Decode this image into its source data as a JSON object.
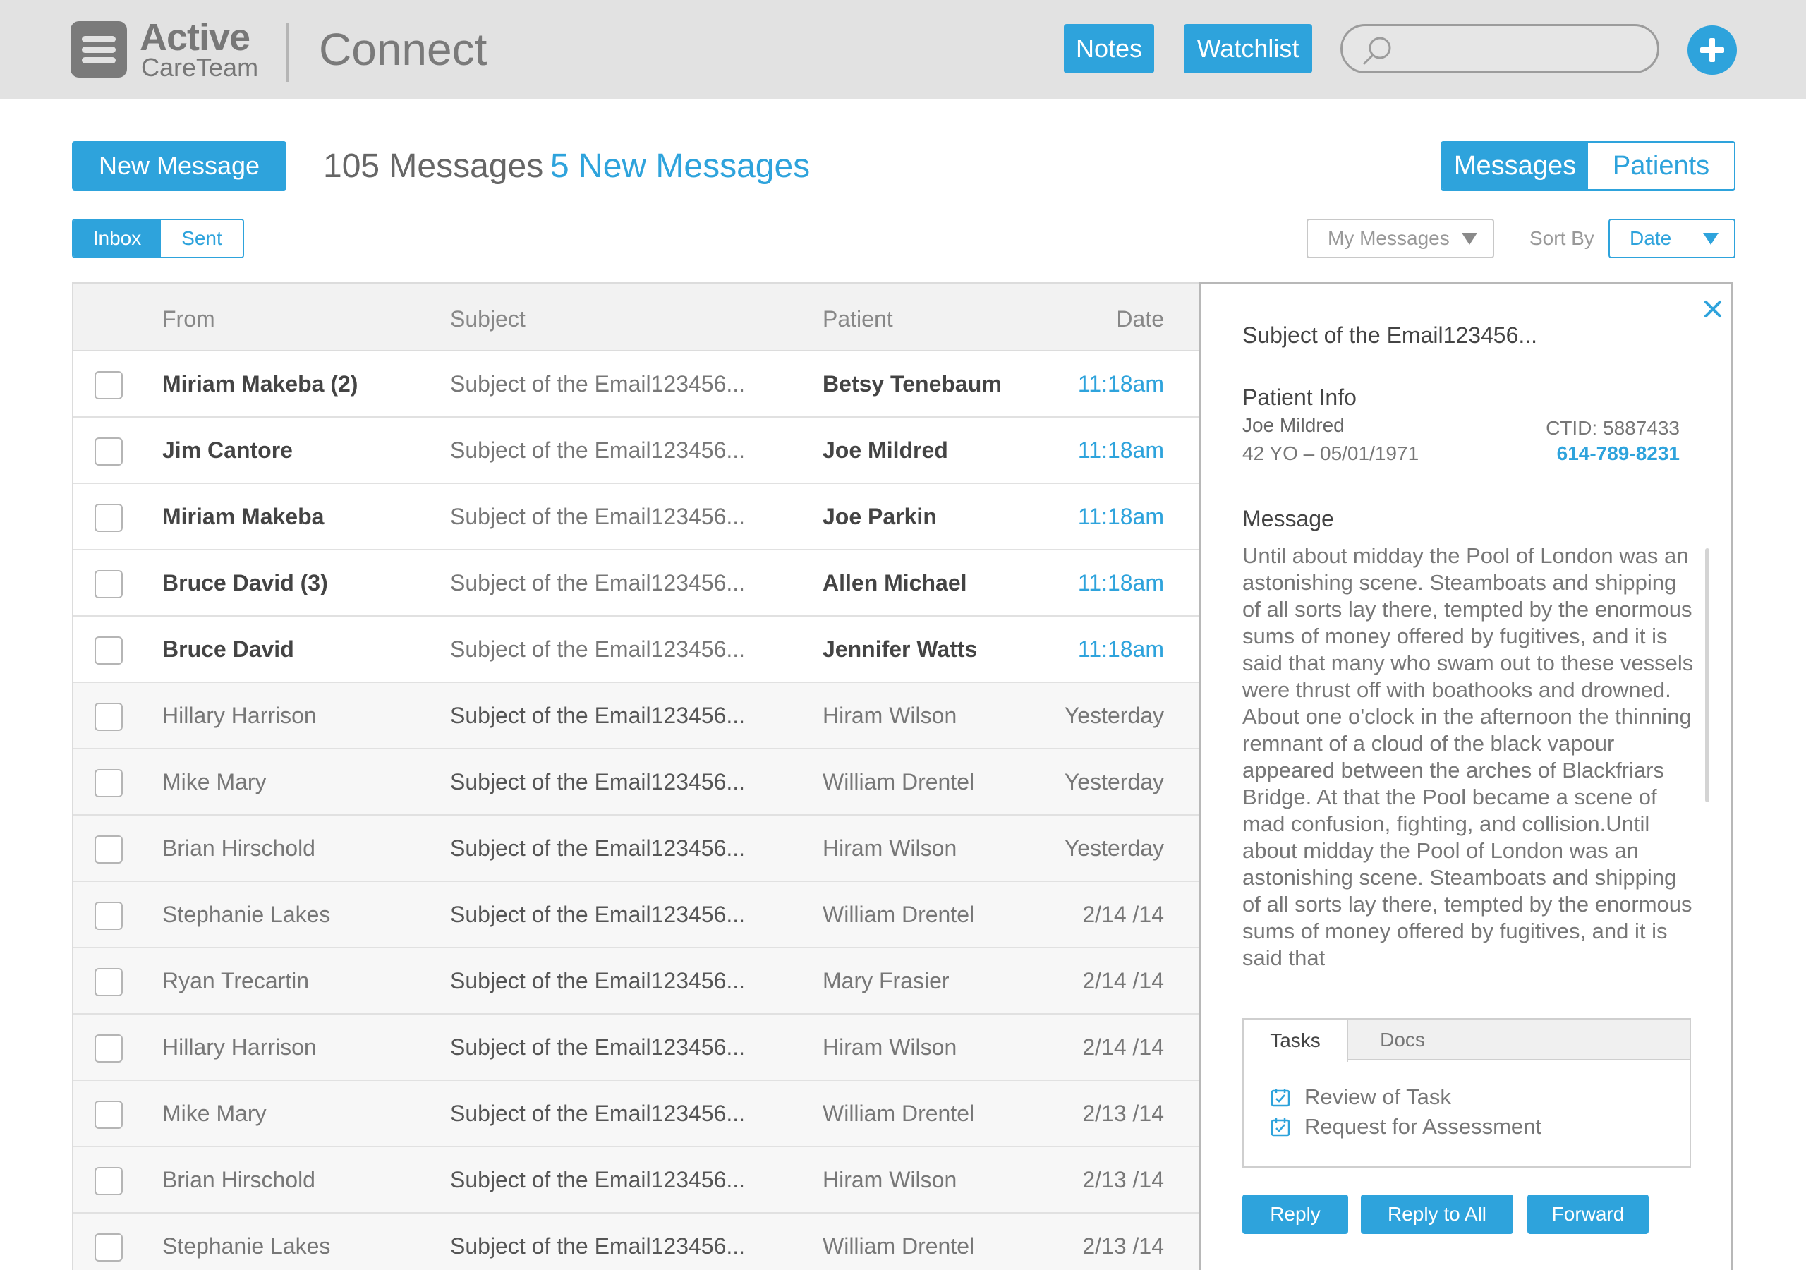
{
  "header": {
    "logo_line1": "Active",
    "logo_line2": "CareTeam",
    "app_title": "Connect",
    "notes_label": "Notes",
    "watchlist_label": "Watchlist",
    "search_placeholder": "",
    "add_icon": "plus-icon"
  },
  "toolbar": {
    "new_message_label": "New Message",
    "message_count": "105 Messages",
    "new_count": "5 New Messages",
    "view_tabs": [
      "Messages",
      "Patients"
    ],
    "active_view": "Messages",
    "box_tabs": [
      "Inbox",
      "Sent"
    ],
    "active_box": "Inbox",
    "filter_value": "My Messages",
    "sort_label": "Sort By",
    "sort_value": "Date"
  },
  "table": {
    "columns": [
      "From",
      "Subject",
      "Patient",
      "Date"
    ],
    "rows": [
      {
        "from": "Miriam Makeba (2)",
        "subject": "Subject of the Email123456...",
        "patient": "Betsy Tenebaum",
        "date": "11:18am",
        "state": "new"
      },
      {
        "from": "Jim Cantore",
        "subject": "Subject of the Email123456...",
        "patient": "Joe Mildred",
        "date": "11:18am",
        "state": "new selected"
      },
      {
        "from": "Miriam Makeba",
        "subject": "Subject of the Email123456...",
        "patient": "Joe Parkin",
        "date": "11:18am",
        "state": "new"
      },
      {
        "from": "Bruce David (3)",
        "subject": "Subject of the Email123456...",
        "patient": "Allen Michael",
        "date": "11:18am",
        "state": "new"
      },
      {
        "from": "Bruce David",
        "subject": "Subject of the Email123456...",
        "patient": "Jennifer Watts",
        "date": "11:18am",
        "state": "new"
      },
      {
        "from": "Hillary Harrison",
        "subject": "Subject of the Email123456...",
        "patient": "Hiram Wilson",
        "date": "Yesterday",
        "state": "old"
      },
      {
        "from": "Mike Mary",
        "subject": "Subject of the Email123456...",
        "patient": "William Drentel",
        "date": "Yesterday",
        "state": "old"
      },
      {
        "from": "Brian Hirschold",
        "subject": "Subject of the Email123456...",
        "patient": "Hiram Wilson",
        "date": "Yesterday",
        "state": "old"
      },
      {
        "from": "Stephanie Lakes",
        "subject": "Subject of the Email123456...",
        "patient": "William Drentel",
        "date": "2/14 /14",
        "state": "old"
      },
      {
        "from": "Ryan Trecartin",
        "subject": "Subject of the Email123456...",
        "patient": "Mary Frasier",
        "date": "2/14 /14",
        "state": "old"
      },
      {
        "from": "Hillary Harrison",
        "subject": "Subject of the Email123456...",
        "patient": "Hiram Wilson",
        "date": "2/14 /14",
        "state": "old"
      },
      {
        "from": "Mike Mary",
        "subject": "Subject of the Email123456...",
        "patient": "William Drentel",
        "date": "2/13 /14",
        "state": "old"
      },
      {
        "from": "Brian Hirschold",
        "subject": "Subject of the Email123456...",
        "patient": "Hiram Wilson",
        "date": "2/13 /14",
        "state": "old"
      },
      {
        "from": "Stephanie Lakes",
        "subject": "Subject of the Email123456...",
        "patient": "William Drentel",
        "date": "2/13 /14",
        "state": "old"
      }
    ]
  },
  "detail": {
    "subject": "Subject of the Email123456...",
    "patient_info_heading": "Patient Info",
    "patient_name": "Joe Mildred",
    "patient_age": "42 YO – 05/01/1971",
    "ctid": "CTID: 5887433",
    "phone": "614-789-8231",
    "message_heading": "Message",
    "message_body": "Until about midday the Pool of London was an astonishing scene. Steamboats and shipping of all sorts lay there, tempted by the enormous sums of money offered by fugitives, and it is said that many who swam out to these vessels were thrust off with boathooks and drowned. About one o'clock in the afternoon the thinning remnant of a cloud of the black vapour appeared between the arches of Blackfriars Bridge. At that the Pool became a scene of mad confusion, fighting, and collision.Until about midday the Pool of London was an astonishing scene. Steamboats and shipping of all sorts lay there, tempted by the enormous sums of money offered by fugitives, and it is said that",
    "tabs": [
      "Tasks",
      "Docs"
    ],
    "active_tab": "Tasks",
    "tasks": [
      "Review of Task",
      "Request for Assessment"
    ],
    "reply_label": "Reply",
    "reply_all_label": "Reply to All",
    "forward_label": "Forward"
  },
  "colors": {
    "accent": "#2ea3dc",
    "header_bg": "#e2e2e2",
    "selected_row": "#e7f3f9"
  }
}
